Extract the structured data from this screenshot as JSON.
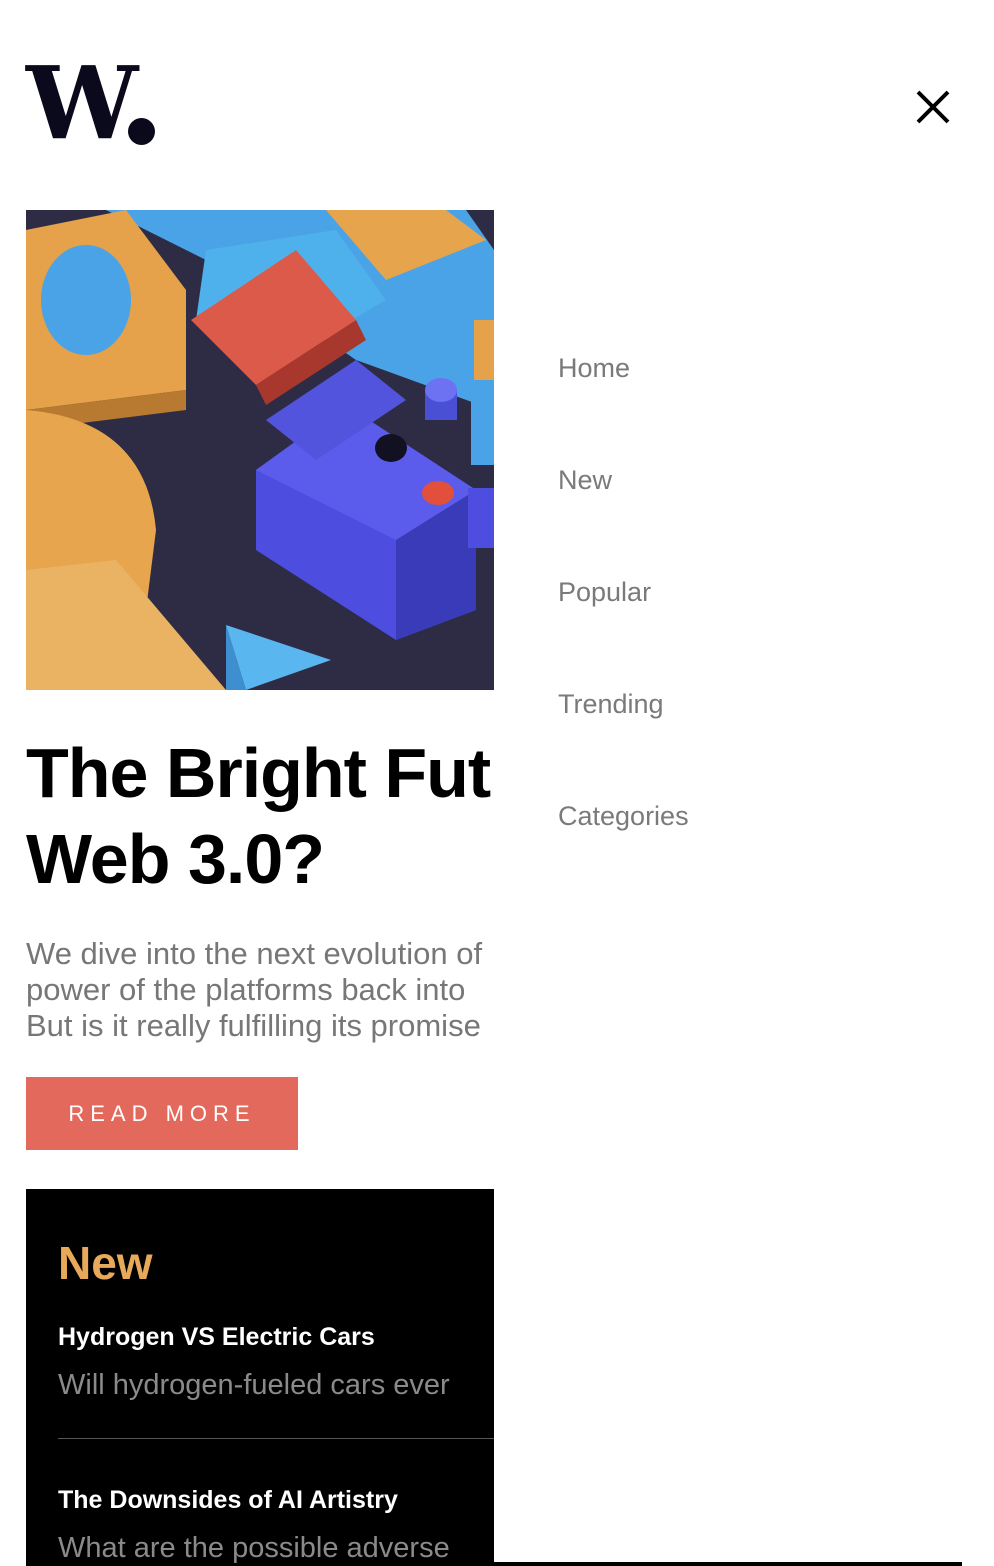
{
  "header": {
    "logo_text": "W",
    "close_icon": "close-icon"
  },
  "hero": {
    "image_icon": "abstract-3d-blocks-image",
    "title_lines": [
      "The Bright Future of",
      "Web 3.0?"
    ],
    "excerpt_lines": [
      "We dive into the next evolution of",
      "power of the platforms back into",
      "But is it really fulfilling its promise"
    ],
    "cta_label": "READ MORE"
  },
  "new_section": {
    "heading": "New",
    "items": [
      {
        "title": "Hydrogen VS Electric Cars",
        "desc": "Will hydrogen-fueled cars ever"
      },
      {
        "title": "The Downsides of AI Artistry",
        "desc": "What are the possible adverse"
      }
    ]
  },
  "nav": {
    "items": [
      "Home",
      "New",
      "Popular",
      "Trending",
      "Categories"
    ]
  },
  "colors": {
    "accent": "#e3695c",
    "new_heading": "#e9a95a",
    "logo": "#0b0a1c"
  }
}
